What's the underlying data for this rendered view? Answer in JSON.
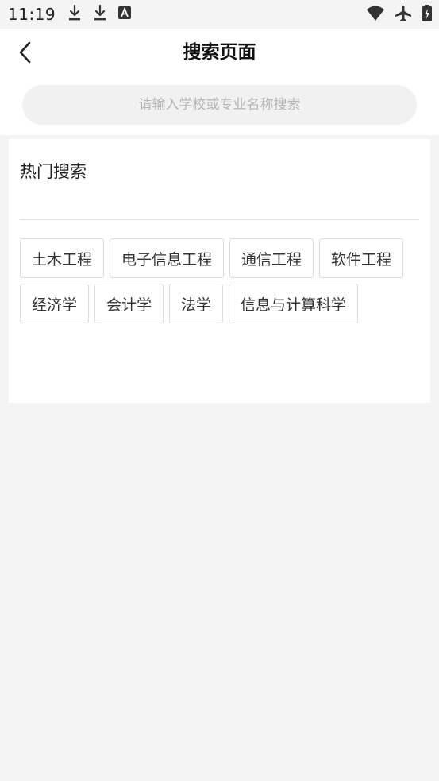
{
  "status_bar": {
    "time": "11:19",
    "left_icons": [
      "download-icon",
      "download-icon",
      "font-a-icon"
    ],
    "right_icons": [
      "wifi-icon",
      "airplane-icon",
      "battery-charging-icon"
    ]
  },
  "nav": {
    "title": "搜索页面",
    "back_icon": "chevron-left-icon"
  },
  "search": {
    "placeholder": "请输入学校或专业名称搜索",
    "value": ""
  },
  "hot_search": {
    "title": "热门搜索",
    "tags": [
      "土木工程",
      "电子信息工程",
      "通信工程",
      "软件工程",
      "经济学",
      "会计学",
      "法学",
      "信息与计算科学"
    ]
  },
  "colors": {
    "background": "#f4f4f4",
    "card": "#ffffff",
    "tag_border": "#dcdcdc",
    "placeholder": "#b5b5b5"
  }
}
